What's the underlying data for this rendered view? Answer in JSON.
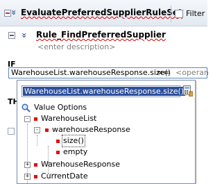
{
  "ruleset": {
    "title": "EvaluatePreferredSupplierRuleSet",
    "filter_label": "Filter"
  },
  "rule": {
    "title": "Rule_FindPreferredSupplier",
    "description": "<enter description>"
  },
  "condition": {
    "if_label": "IF",
    "expression": "WarehouseList.warehouseResponse.size()",
    "operator": "==",
    "operand_placeholder": "<operan",
    "then_label": "TH"
  },
  "popup": {
    "field_value": "WarehouseList.warehouseResponse.size()",
    "icon": "calculator-icon",
    "tree": {
      "root_label": "Value Options",
      "items": [
        {
          "label": "WarehouseList",
          "level": 0,
          "toggle": "-"
        },
        {
          "label": "warehouseResponse",
          "level": 1,
          "toggle": "-"
        },
        {
          "label": "size()",
          "level": 2,
          "toggle": "",
          "selected": true
        },
        {
          "label": "empty",
          "level": 2,
          "toggle": ""
        },
        {
          "label": "WarehouseResponse",
          "level": 0,
          "toggle": "+"
        },
        {
          "label": "CurrentDate",
          "level": 0,
          "toggle": "+"
        }
      ]
    }
  },
  "colors": {
    "selection": "#2c4f9c",
    "error_underline": "#d40000",
    "node_marker": "#dd1111"
  }
}
